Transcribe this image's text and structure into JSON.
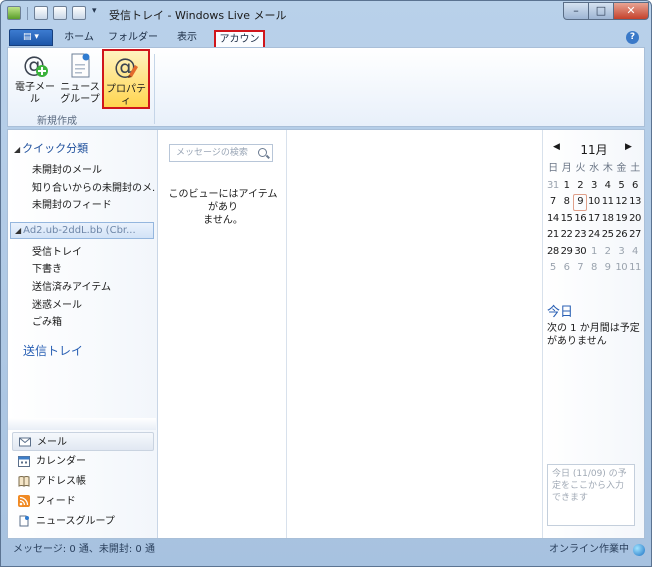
{
  "window": {
    "title": "受信トレイ - Windows Live メール",
    "controls": {
      "minimize": "–",
      "maximize": "□",
      "close": "✕"
    }
  },
  "ribbon": {
    "app_menu_label": "▤ ▾",
    "tabs": [
      "ホーム",
      "フォルダー",
      "表示",
      "アカウント"
    ],
    "active_tab": "アカウント",
    "help": "?",
    "buttons": {
      "email": "電子メール",
      "newsgroup_line1": "ニュース",
      "newsgroup_line2": "グループ",
      "properties": "プロパティ"
    },
    "group_label": "新規作成"
  },
  "sidebar": {
    "quick_views": {
      "title": "クイック分類",
      "items": [
        "未開封のメール",
        "知り合いからの未開封のメ...",
        "未開封のフィード"
      ]
    },
    "account_label": "Ad2.ub-2ddL.bb (Cbr...",
    "folders": [
      "受信トレイ",
      "下書き",
      "送信済みアイテム",
      "迷惑メール",
      "ごみ箱"
    ],
    "outbox": "送信トレイ",
    "bottom_nav": [
      "メール",
      "カレンダー",
      "アドレス帳",
      "フィード",
      "ニュースグループ"
    ]
  },
  "message_list": {
    "search_placeholder": "メッセージの検索",
    "empty_line1": "このビューにはアイテムがあり",
    "empty_line2": "ません。"
  },
  "calendar": {
    "month": "11月",
    "prev": "◀",
    "next": "▶",
    "weekdays": [
      "日",
      "月",
      "火",
      "水",
      "木",
      "金",
      "土"
    ],
    "weeks": [
      [
        "31",
        "1",
        "2",
        "3",
        "4",
        "5",
        "6"
      ],
      [
        "7",
        "8",
        "9",
        "10",
        "11",
        "12",
        "13"
      ],
      [
        "14",
        "15",
        "16",
        "17",
        "18",
        "19",
        "20"
      ],
      [
        "21",
        "22",
        "23",
        "24",
        "25",
        "26",
        "27"
      ],
      [
        "28",
        "29",
        "30",
        "1",
        "2",
        "3",
        "4"
      ],
      [
        "5",
        "6",
        "7",
        "8",
        "9",
        "10",
        "11"
      ]
    ],
    "today_day": "9",
    "today_title": "今日",
    "today_note": "次の 1 か月間は予定がありません",
    "quick_add_placeholder": "今日 (11/09) の予定をここから入力できます"
  },
  "status": {
    "left": "メッセージ: 0 通、未開封: 0 通",
    "right": "オンライン作業中"
  },
  "colors": {
    "highlight_red": "#d0161b",
    "link_blue": "#2a60b4",
    "frame_blue": "#b9d1ea"
  }
}
